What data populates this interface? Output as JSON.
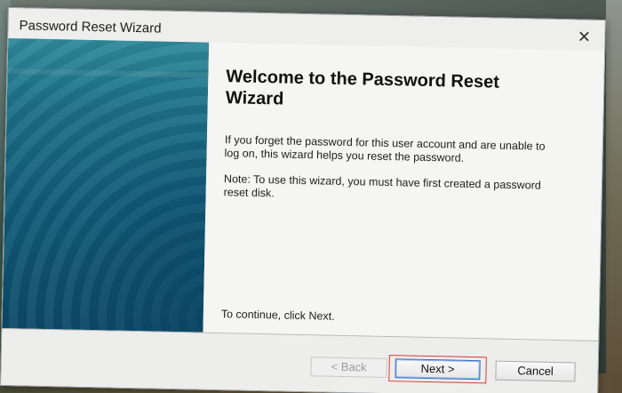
{
  "window": {
    "title": "Password Reset Wizard",
    "close_glyph": "✕"
  },
  "content": {
    "heading": "Welcome to the Password Reset Wizard",
    "paragraph1": "If you forget the password for this user account and are unable to log on, this wizard helps you reset the password.",
    "paragraph2": "Note: To use this wizard, you must have first created a password reset disk.",
    "continue_text": "To continue, click Next."
  },
  "buttons": {
    "back_label": "< Back",
    "next_label": "Next >",
    "cancel_label": "Cancel"
  },
  "colors": {
    "side_panel": "#1d7189",
    "highlight_border": "#d63a3a"
  }
}
